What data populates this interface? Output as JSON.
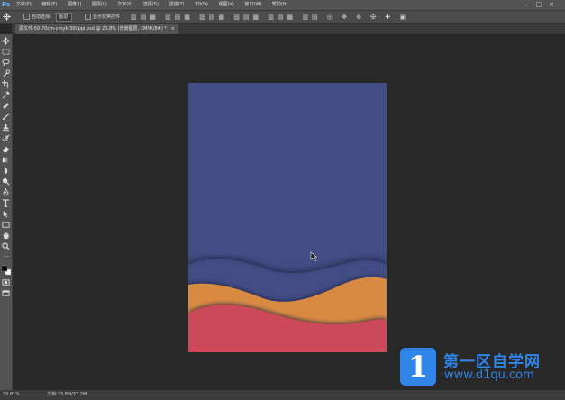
{
  "app": {
    "logo": "Ps"
  },
  "menu": [
    "文件(F)",
    "编辑(E)",
    "图像(I)",
    "图层(L)",
    "文字(Y)",
    "选择(S)",
    "滤镜(T)",
    "3D(D)",
    "视图(V)",
    "窗口(W)",
    "帮助(H)"
  ],
  "window_controls": {
    "minimize": "–",
    "maximize": "□",
    "close": "×"
  },
  "options": {
    "auto_select_label": "自动选择：",
    "auto_select_value": "图层",
    "show_transform_label": "显示变换控件"
  },
  "tab": {
    "title": "源文件-50-70cm-cmyk-300ppi.psd @ 20.8% (背景图层, CMYK/8#) *",
    "close": "×"
  },
  "status": {
    "zoom": "20.81%",
    "doc": "文档:23.8M/37.2M"
  },
  "watermark": {
    "badge": "1",
    "title": "第一区自学网",
    "url": "www.d1qu.com"
  },
  "colors": {
    "doc_blue": "#434d85",
    "wave_orange": "#d98a43",
    "wave_red": "#cb4a58",
    "brand_blue": "#2f85e8"
  },
  "tool_icons": [
    "move-icon",
    "marquee-icon",
    "lasso-icon",
    "quick-select-icon",
    "crop-icon",
    "eyedropper-icon",
    "healing-icon",
    "brush-icon",
    "stamp-icon",
    "history-brush-icon",
    "eraser-icon",
    "gradient-icon",
    "blur-icon",
    "dodge-icon",
    "pen-icon",
    "type-icon",
    "path-select-icon",
    "shape-icon",
    "hand-icon",
    "zoom-icon",
    "more-icon",
    "color-swatch-icon",
    "quickmask-icon",
    "screen-mode-icon"
  ]
}
